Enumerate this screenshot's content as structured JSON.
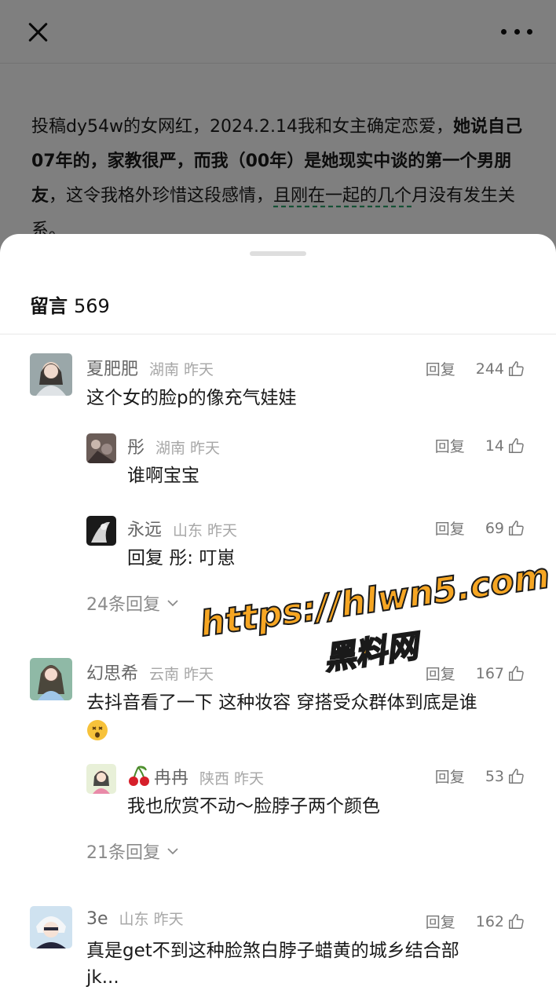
{
  "article": {
    "p1": "投稿dy54w的女网红，2024.2.14我和女主确定恋爱，",
    "p_bold": "她说自己07年的，家教很严，而我（00年）是她现实中谈的第一个男朋友",
    "p2": "，这令我格外珍惜这段感情，",
    "p_under": "且刚在一起的几个",
    "p3": "月没有发生关系。"
  },
  "sheet": {
    "title": "留言",
    "count": "569"
  },
  "labels": {
    "reply": "回复"
  },
  "comments": [
    {
      "nick": "夏肥肥",
      "loc": "湖南 昨天",
      "likes": "244",
      "text": "这个女的脸p的像充气娃娃",
      "replies": [
        {
          "nick": "彤",
          "loc": "湖南 昨天",
          "likes": "14",
          "text": "谁啊宝宝"
        },
        {
          "nick": "永远",
          "loc": "山东 昨天",
          "likes": "69",
          "text": "回复 彤: 叮崽"
        }
      ],
      "more": "24条回复"
    },
    {
      "nick": "幻思希",
      "loc": "云南 昨天",
      "likes": "167",
      "text": "去抖音看了一下 这种妆容 穿搭受众群体到底是谁",
      "replies": [
        {
          "nick": "冉冉",
          "loc": "陕西 昨天",
          "likes": "53",
          "text": "我也欣赏不动～脸脖子两个颜色"
        }
      ],
      "more": "21条回复"
    },
    {
      "nick": "3e",
      "loc": "山东 昨天",
      "likes": "162",
      "text": "真是get不到这种脸煞白脖子蜡黄的城乡结合部",
      "text2": "jk..."
    }
  ],
  "watermark": {
    "line1": "https://hlwn5.com",
    "line2": "黑料网"
  }
}
